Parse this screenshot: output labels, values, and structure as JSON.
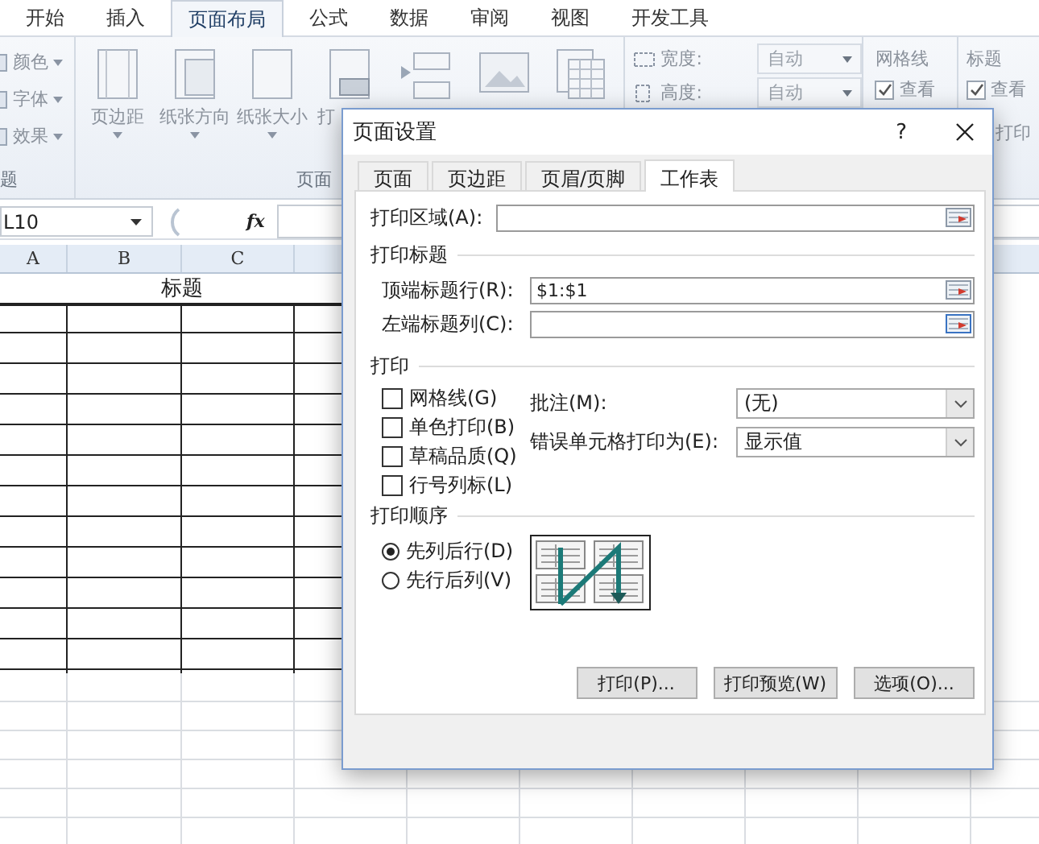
{
  "ribbon_tabs": [
    {
      "label": "开始",
      "selected": false
    },
    {
      "label": "插入",
      "selected": false
    },
    {
      "label": "页面布局",
      "selected": true
    },
    {
      "label": "公式",
      "selected": false
    },
    {
      "label": "数据",
      "selected": false
    },
    {
      "label": "审阅",
      "selected": false
    },
    {
      "label": "视图",
      "selected": false
    },
    {
      "label": "开发工具",
      "selected": false
    }
  ],
  "theme_group": {
    "items": [
      "颜色",
      "字体",
      "效果"
    ],
    "label": "题"
  },
  "page_setup_group": {
    "buttons": [
      "页边距",
      "纸张方向",
      "纸张大小",
      "打"
    ],
    "label": "页面"
  },
  "scale_group": {
    "width_label": "宽度:",
    "width_value": "自动",
    "height_label": "高度:",
    "height_value": "自动"
  },
  "gridlines_group": {
    "title": "网格线",
    "view_label": "查看",
    "view_checked": true
  },
  "headings_group": {
    "title": "标题",
    "view_label": "查看",
    "view_checked": true,
    "print_label": "打印"
  },
  "formula_bar": {
    "name_box": "L10",
    "function_label": "fx"
  },
  "sheet": {
    "columns": [
      "A",
      "B",
      "C"
    ],
    "title": "标题"
  },
  "dialog": {
    "title": "页面设置",
    "help": "?",
    "tabs": [
      {
        "label": "页面",
        "selected": false
      },
      {
        "label": "页边距",
        "selected": false
      },
      {
        "label": "页眉/页脚",
        "selected": false
      },
      {
        "label": "工作表",
        "selected": true
      }
    ],
    "print_area": {
      "label": "打印区域(A):"
    },
    "print_titles": {
      "heading": "打印标题",
      "fields": [
        {
          "label": "顶端标题行(R):",
          "value": "$1:$1"
        },
        {
          "label": "左端标题列(C):"
        }
      ]
    },
    "print": {
      "heading": "打印",
      "options": [
        {
          "label": "网格线(G)",
          "checked": false
        },
        {
          "label": "单色打印(B)",
          "checked": false
        },
        {
          "label": "草稿品质(Q)",
          "checked": false
        },
        {
          "label": "行号列标(L)",
          "checked": false
        }
      ],
      "dropdowns": [
        {
          "label": "批注(M):",
          "value": "(无)"
        },
        {
          "label": "错误单元格打印为(E):",
          "value": "显示值"
        }
      ]
    },
    "page_order": {
      "heading": "打印顺序",
      "options": [
        {
          "label": "先列后行(D)",
          "selected": true
        },
        {
          "label": "先行后列(V)",
          "selected": false
        }
      ]
    },
    "buttons": [
      "打印(P)...",
      "打印预览(W)",
      "选项(O)..."
    ]
  }
}
